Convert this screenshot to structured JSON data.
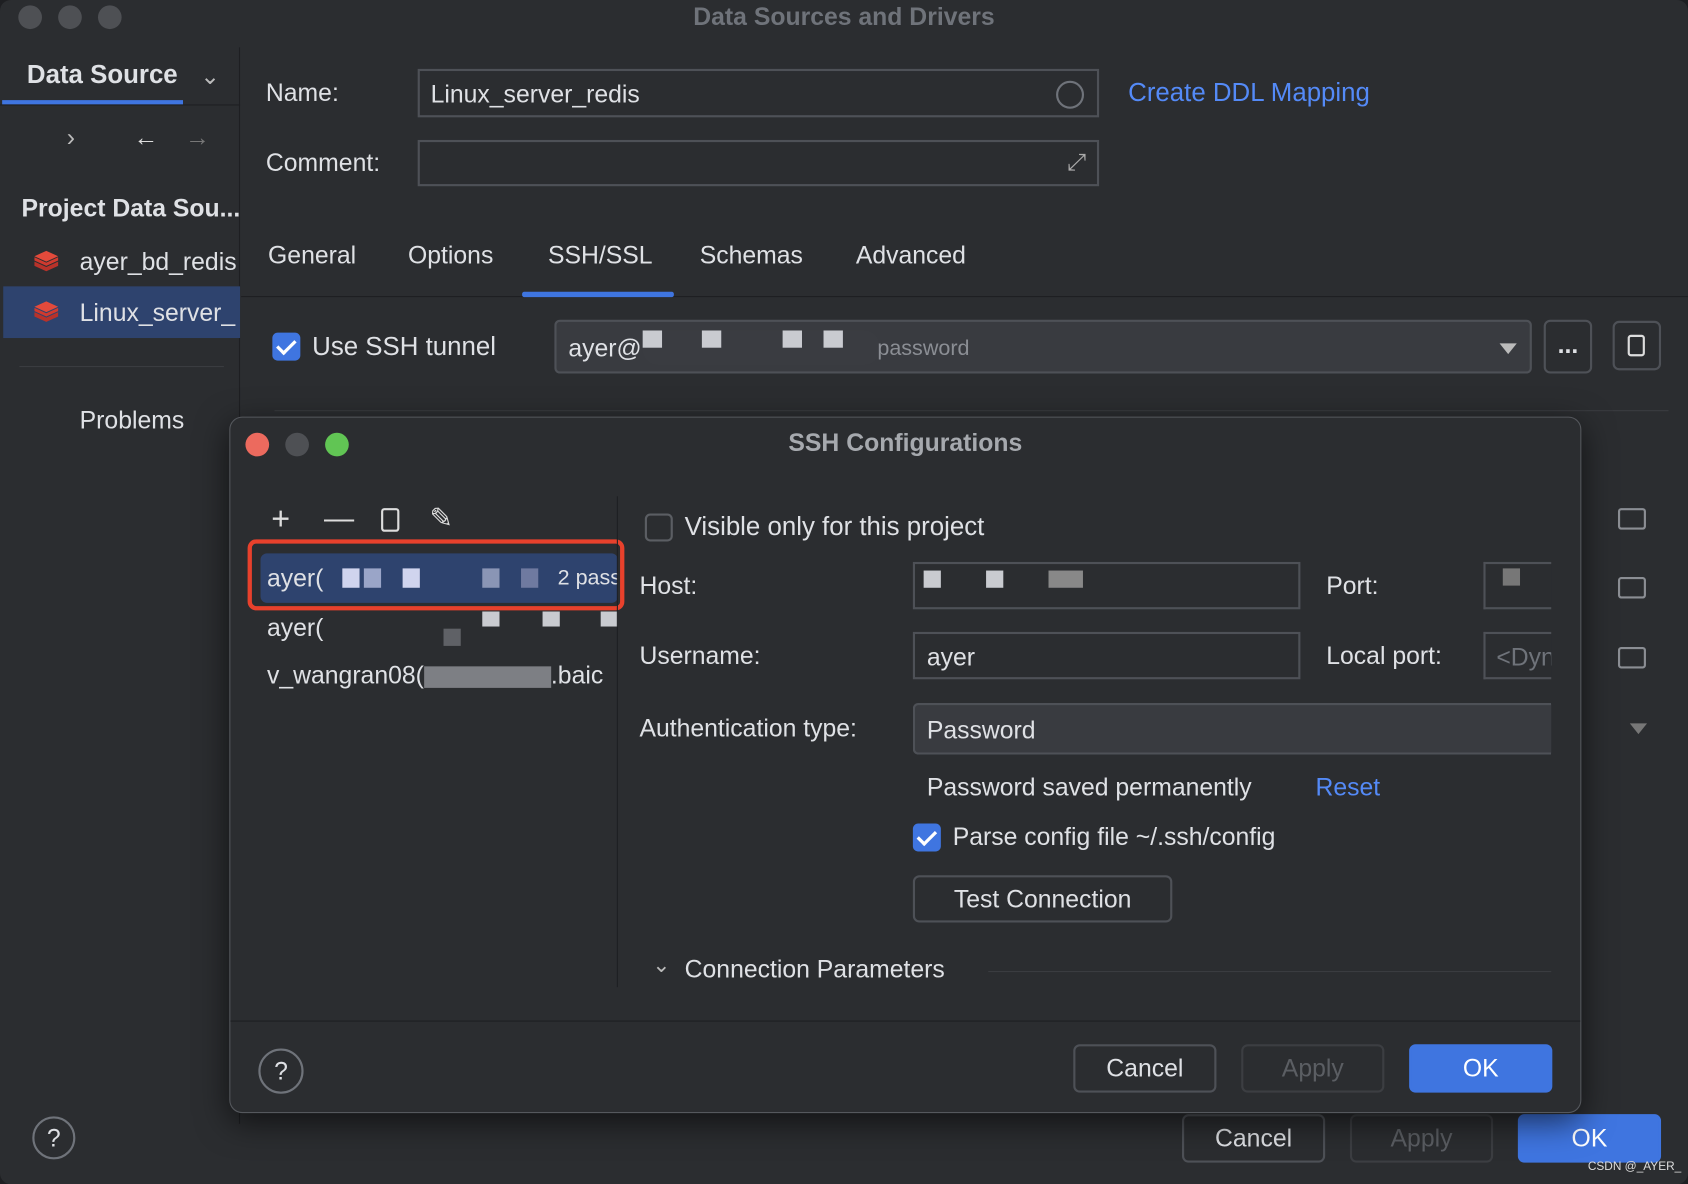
{
  "window": {
    "title": "Data Sources and Drivers"
  },
  "sidebar": {
    "tab_label": "Data Source",
    "section_title": "Project Data Sou...",
    "items": [
      {
        "label": "ayer_bd_redis",
        "selected": false
      },
      {
        "label": "Linux_server_",
        "selected": true
      }
    ],
    "problems_label": "Problems"
  },
  "form": {
    "name_label": "Name:",
    "name_value": "Linux_server_redis",
    "comment_label": "Comment:",
    "comment_value": "",
    "ddl_link": "Create DDL Mapping",
    "tabs": [
      {
        "label": "General"
      },
      {
        "label": "Options"
      },
      {
        "label": "SSH/SSL",
        "active": true
      },
      {
        "label": "Schemas"
      },
      {
        "label": "Advanced"
      }
    ],
    "use_ssh_label": "Use SSH tunnel",
    "use_ssh_checked": true,
    "ssh_select_prefix": "ayer@",
    "ssh_select_suffix": "password",
    "more_label": "..."
  },
  "ssh_dialog": {
    "title": "SSH Configurations",
    "list": [
      {
        "prefix": "ayer(",
        "suffix": "2 pass",
        "selected": true
      },
      {
        "prefix": "ayer(",
        "suffix": ""
      },
      {
        "prefix": "v_wangran08(",
        "suffix": ".baic"
      }
    ],
    "visible_only_label": "Visible only for this project",
    "visible_only_checked": false,
    "host_label": "Host:",
    "port_label": "Port:",
    "username_label": "Username:",
    "username_value": "ayer",
    "local_port_label": "Local port:",
    "local_port_placeholder": "<Dynamic>",
    "auth_label": "Authentication type:",
    "auth_value": "Password",
    "password_saved": "Password saved permanently",
    "reset_link": "Reset",
    "parse_config_label": "Parse config file ~/.ssh/config",
    "parse_config_checked": true,
    "test_connection": "Test Connection",
    "connection_params": "Connection Parameters",
    "help": "?",
    "cancel": "Cancel",
    "apply": "Apply",
    "ok": "OK"
  },
  "footer": {
    "help": "?",
    "cancel": "Cancel",
    "apply": "Apply",
    "ok": "OK"
  },
  "watermark": "CSDN @_AYER_",
  "colors": {
    "accent": "#3f75e0",
    "link": "#548af7",
    "highlight": "#e8412c",
    "background": "#2b2d30"
  }
}
